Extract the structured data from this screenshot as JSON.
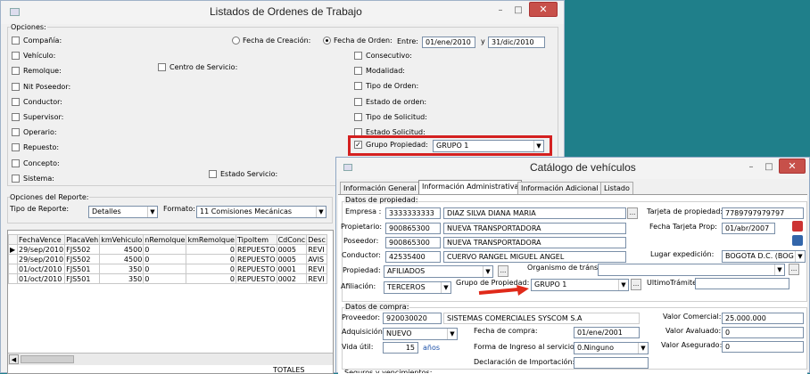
{
  "main_window": {
    "title": "Listados de Ordenes de Trabajo",
    "min": "–",
    "max": "□",
    "close": "✕"
  },
  "options": {
    "legend": "Opciones:",
    "left": [
      "Compañía:",
      "Vehículo:",
      "Remolque:",
      "Nit Poseedor:",
      "Conductor:",
      "Supervisor:",
      "Operario:",
      "Repuesto:",
      "Concepto:",
      "Sistema:"
    ],
    "centro": "Centro de Servicio:",
    "estado_servicio": "Estado Servicio:",
    "fecha_creacion": "Fecha de Creación:",
    "fecha_orden": "Fecha de Orden:",
    "entre": "Entre:",
    "fecha_desde": "01/ene/2010",
    "y": "y",
    "fecha_hasta": "31/dic/2010",
    "right": [
      "Consecutivo:",
      "Modalidad:",
      "Tipo de Orden:",
      "Estado de orden:",
      "Tipo de Solicitud:",
      "Estado Solicitud:"
    ],
    "grupo_label": "Grupo Propiedad:",
    "grupo_value": "GRUPO 1"
  },
  "report": {
    "legend": "Opciones del Reporte:",
    "tipo_label": "Tipo de Reporte:",
    "tipo_value": "Detalles",
    "formato_label": "Formato:",
    "formato_value": "11 Comisiones Mecánicas"
  },
  "grid": {
    "headers": [
      "FechaVence",
      "PlacaVeh",
      "kmVehiculo",
      "nRemolque",
      "kmRemolque",
      "TipoItem",
      "CdConc",
      "Desc"
    ],
    "rows": [
      [
        "29/sep/2010",
        "FJS502",
        "4500",
        "0",
        "0",
        "REPUESTO",
        "0005",
        "REVI"
      ],
      [
        "29/sep/2010",
        "FJS502",
        "4500",
        "0",
        "0",
        "REPUESTO",
        "0005",
        "AVIS"
      ],
      [
        "01/oct/2010",
        "FJS501",
        "350",
        "0",
        "0",
        "REPUESTO",
        "0001",
        "REVI"
      ],
      [
        "01/oct/2010",
        "FJS501",
        "350",
        "0",
        "0",
        "REPUESTO",
        "0002",
        "REVI"
      ]
    ],
    "totals": "TOTALES"
  },
  "catalog": {
    "title": "Catálogo de vehículos",
    "tabs": [
      "Información General",
      "Información Administrativa",
      "Información Adicional",
      "Listado"
    ],
    "prop_legend": "Datos de propiedad:",
    "empresa_label": "Empresa :",
    "empresa_id": "3333333333",
    "empresa_name": "DIAZ SILVA DIANA MARIA",
    "propietario_label": "Propietario:",
    "propietario_id": "900865300",
    "propietario_name": "NUEVA TRANSPORTADORA",
    "poseedor_label": "Poseedor:",
    "poseedor_id": "900865300",
    "poseedor_name": "NUEVA TRANSPORTADORA",
    "conductor_label": "Conductor:",
    "conductor_id": "42535400",
    "conductor_name": "CUERVO RANGEL MIGUEL ANGEL",
    "propiedad_label": "Propiedad:",
    "propiedad_value": "AFILIADOS",
    "organismo_label": "Organismo de tránsito:",
    "afiliacion_label": "Afiliación:",
    "afiliacion_value": "TERCEROS",
    "grupo_label": "Grupo de Propiedad:",
    "grupo_value": "GRUPO 1",
    "ultimo_label": "UltimoTrámite:",
    "tarjeta_label": "Tarjeta de propiedad:",
    "tarjeta_value": "7789797979797",
    "fecha_tarjeta_label": "Fecha Tarjeta Prop:",
    "fecha_tarjeta_value": "01/abr/2007",
    "lugar_label": "Lugar expedición:",
    "lugar_value": "BOGOTA D.C. (BOG",
    "compra_legend": "Datos de compra:",
    "proveedor_label": "Proveedor:",
    "proveedor_id": "920030020",
    "proveedor_name": "SISTEMAS COMERCIALES SYSCOM S.A",
    "adquisicion_label": "Adquisición:",
    "adquisicion_value": "NUEVO",
    "fecha_compra_label": "Fecha de compra:",
    "fecha_compra_value": "01/ene/2001",
    "vida_label": "Vida útil:",
    "vida_value": "15",
    "vida_unit": "años",
    "forma_label": "Forma de Ingreso al servicio:",
    "forma_value": "0.Ninguno",
    "declaracion_label": "Declaración de Importación:",
    "valor_comercial_label": "Valor Comercial:",
    "valor_comercial_value": "25.000.000",
    "valor_avaluado_label": "Valor Avaluado:",
    "valor_avaluado_value": "0",
    "valor_asegurado_label": "Valor Asegurado:",
    "valor_asegurado_value": "0",
    "next_legend": "Seguros y vencimientos:"
  },
  "colors": {
    "desktop": "#1f7f8a",
    "highlight": "#d42020",
    "arrow": "#e02a1a"
  }
}
